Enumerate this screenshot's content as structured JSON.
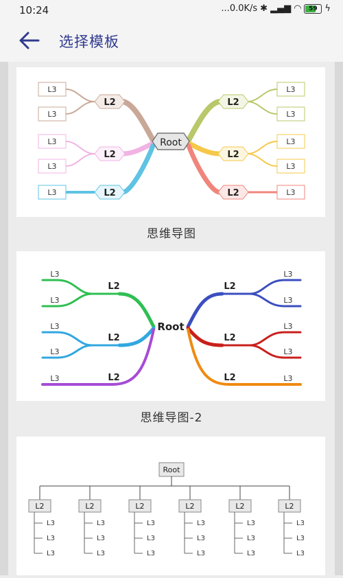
{
  "status": {
    "time": "10:24",
    "network": "...0.0K/s",
    "battery": "59"
  },
  "appbar": {
    "title": "选择模板"
  },
  "templates": [
    {
      "caption": "思维导图",
      "root": "Root",
      "l2": "L2",
      "l3": "L3"
    },
    {
      "caption": "思维导图-2",
      "root": "Root",
      "l2": "L2",
      "l3": "L3"
    },
    {
      "caption": "",
      "root": "Root",
      "l2": "L2",
      "l3": "L3"
    }
  ],
  "colors": {
    "accent": "#2f3a8f",
    "branches1": [
      "#c9a897",
      "#f1b3e4",
      "#5fc3e3",
      "#b8c86a",
      "#f6c84a",
      "#f0857b"
    ],
    "branches2": [
      "#2fbf52",
      "#31a7e0",
      "#a64bd6",
      "#3b4fbf",
      "#c9201c",
      "#f08a12"
    ]
  }
}
